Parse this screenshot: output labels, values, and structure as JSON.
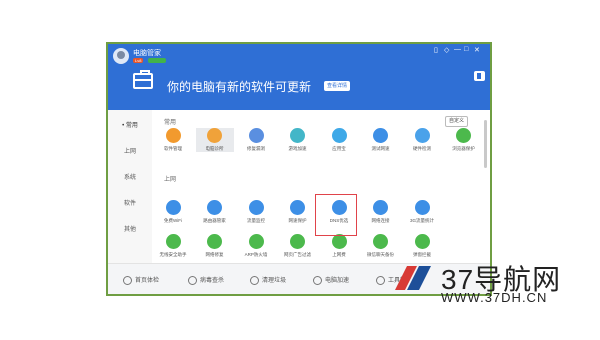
{
  "app": {
    "name": "电脑管家",
    "level": "Lv8"
  },
  "window_controls": [
    "▯",
    "◇",
    "—",
    "□",
    "✕"
  ],
  "banner": {
    "text": "你的电脑有新的软件可更新",
    "button": "查看详情"
  },
  "sidebar": {
    "items": [
      {
        "label": "• 常用",
        "active": true
      },
      {
        "label": "上网",
        "active": false
      },
      {
        "label": "系统",
        "active": false
      },
      {
        "label": "软件",
        "active": false
      },
      {
        "label": "其他",
        "active": false
      }
    ]
  },
  "sections": {
    "common": "常用",
    "internet": "上网"
  },
  "custom_button": "自定义",
  "common_tools": [
    {
      "label": "软件管理",
      "icon": "clover-icon",
      "color": "#f29a2e"
    },
    {
      "label": "电脑诊所",
      "icon": "clinic-icon",
      "color": "#f0a23a"
    },
    {
      "label": "修复漏洞",
      "icon": "shield-repair-icon",
      "color": "#5a8fe0"
    },
    {
      "label": "游戏加速",
      "icon": "game-speed-icon",
      "color": "#43b6c8"
    },
    {
      "label": "应用宝",
      "icon": "app-store-icon",
      "color": "#3fa9e8"
    },
    {
      "label": "测试网速",
      "icon": "speedtest-icon",
      "color": "#3d8fe6"
    },
    {
      "label": "硬件检测",
      "icon": "hardware-icon",
      "color": "#4aa2ea"
    },
    {
      "label": "浏览器保护",
      "icon": "browser-shield-icon",
      "color": "#4cb94c"
    }
  ],
  "internet_tools": [
    {
      "label": "免费WiFi",
      "icon": "wifi-icon",
      "color": "#3d8fe6"
    },
    {
      "label": "路由器管家",
      "icon": "router-icon",
      "color": "#3d8fe6"
    },
    {
      "label": "流量监控",
      "icon": "traffic-icon",
      "color": "#3d8fe6"
    },
    {
      "label": "网速保护",
      "icon": "speed-protect-icon",
      "color": "#3d8fe6"
    },
    {
      "label": "DNS优选",
      "icon": "dns-icon",
      "color": "#3d8fe6"
    },
    {
      "label": "网络连接",
      "icon": "network-icon",
      "color": "#3d8fe6"
    },
    {
      "label": "3G流量统计",
      "icon": "3g-icon",
      "color": "#3d8fe6"
    }
  ],
  "internet_tools_row2": [
    {
      "label": "无线安全助手",
      "icon": "wireless-shield-icon",
      "color": "#4cb94c"
    },
    {
      "label": "网络修复",
      "icon": "wrench-icon",
      "color": "#4cb94c"
    },
    {
      "label": "ARP防火墙",
      "icon": "arp-icon",
      "color": "#4cb94c"
    },
    {
      "label": "网页广告过滤",
      "icon": "ad-filter-icon",
      "color": "#4cb94c"
    },
    {
      "label": "上网费",
      "icon": "web-fee-icon",
      "color": "#4cb94c"
    },
    {
      "label": "微信聊天备份",
      "icon": "wechat-icon",
      "color": "#4cb94c"
    },
    {
      "label": "弹窗拦截",
      "icon": "popup-block-icon",
      "color": "#4cb94c"
    }
  ],
  "bottom_nav": [
    {
      "label": "首页体检",
      "icon": "home-check-icon"
    },
    {
      "label": "病毒查杀",
      "icon": "virus-scan-icon"
    },
    {
      "label": "清理垃圾",
      "icon": "trash-icon"
    },
    {
      "label": "电脑加速",
      "icon": "rocket-icon"
    },
    {
      "label": "工具箱",
      "icon": "toolbox-icon"
    }
  ],
  "watermark": {
    "title": "37导航网",
    "url": "WWW.37DH.CN"
  }
}
